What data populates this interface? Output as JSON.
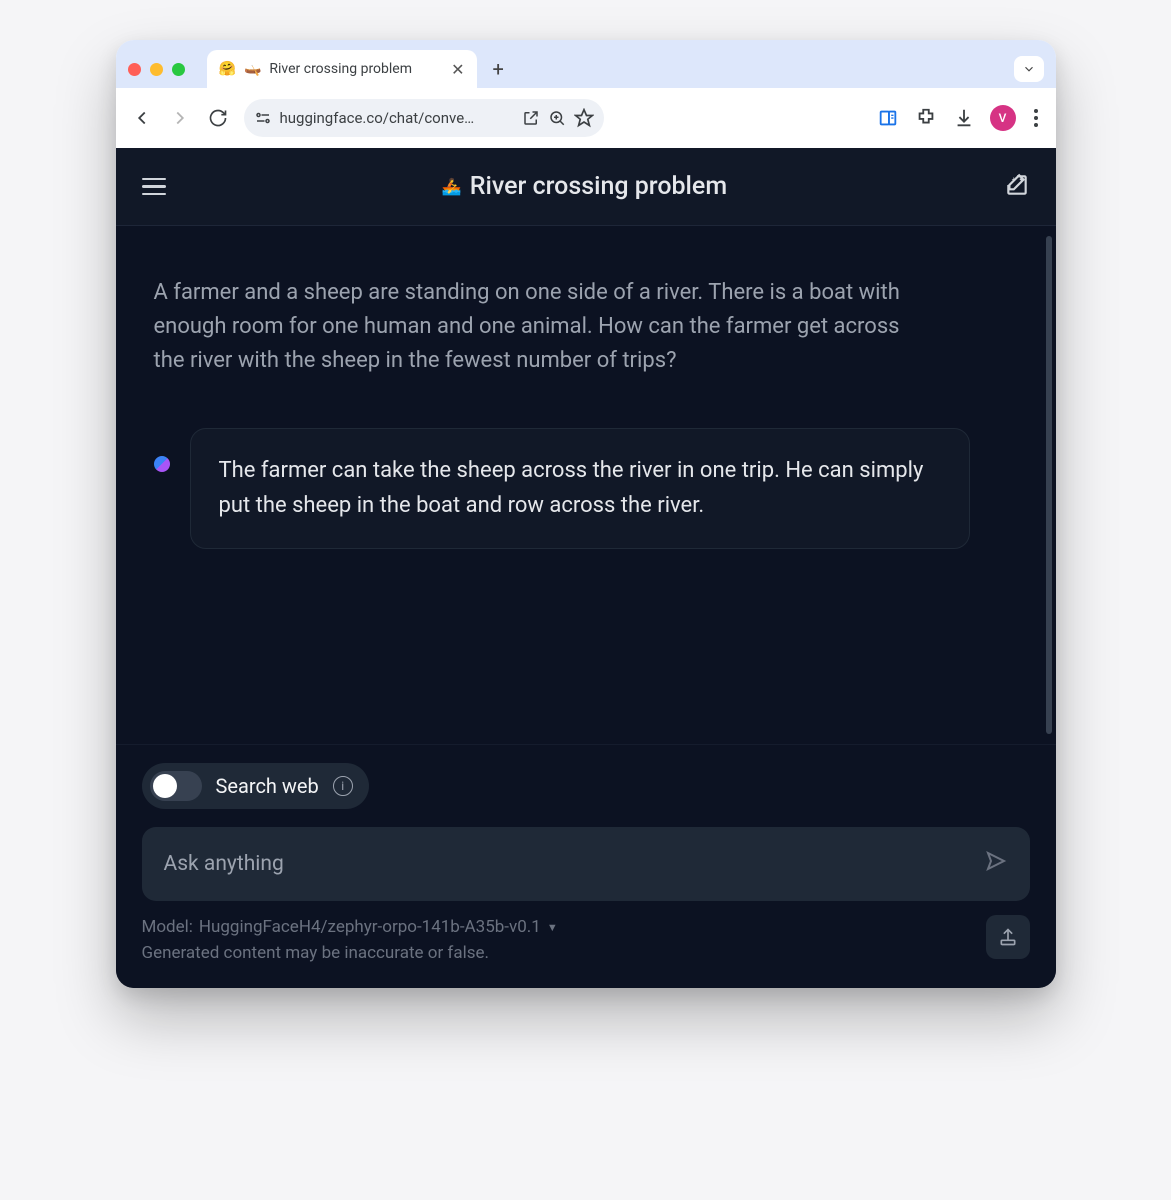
{
  "browser": {
    "tab": {
      "favicon_emoji": "🤗",
      "secondary_emoji": "🛶",
      "title": "River crossing problem"
    },
    "url": "huggingface.co/chat/conve…",
    "avatar_letter": "V"
  },
  "app": {
    "header": {
      "emoji": "🚣",
      "title": "River crossing problem"
    },
    "messages": {
      "user": "A farmer and a sheep are standing on one side of a river. There is a boat with enough room for one human and one animal. How can the farmer get across the river with the sheep in the fewest number of trips?",
      "assistant": "The farmer can take the sheep across the river in one trip. He can simply put the sheep in the boat and row across the river."
    },
    "composer": {
      "search_web_label": "Search web",
      "placeholder": "Ask anything"
    },
    "footer": {
      "model_prefix": "Model: ",
      "model_name": "HuggingFaceH4/zephyr-orpo-141b-A35b-v0.1",
      "disclaimer": "Generated content may be inaccurate or false."
    }
  }
}
